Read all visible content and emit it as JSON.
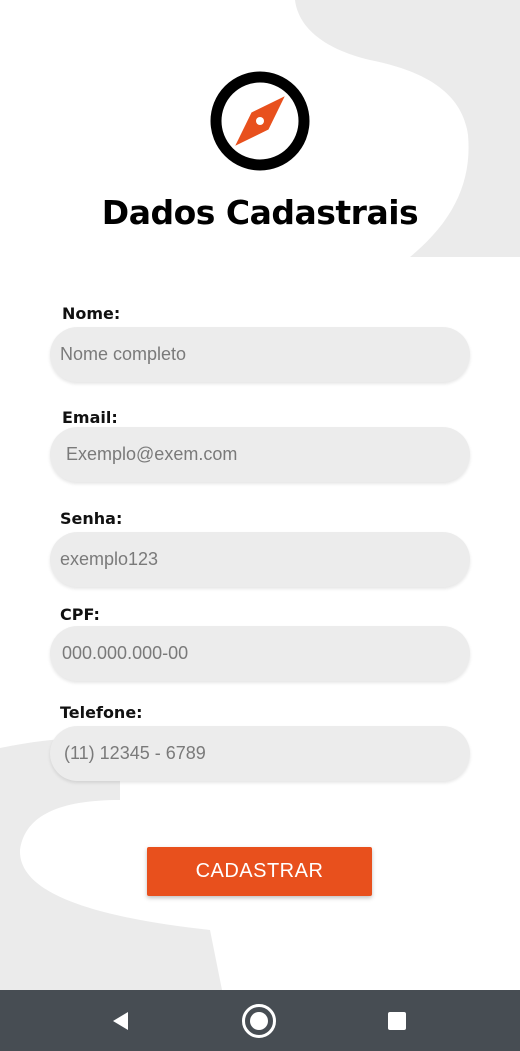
{
  "header": {
    "title": "Dados Cadastrais",
    "logo_icon": "compass-icon"
  },
  "form": {
    "fields": [
      {
        "label": "Nome:",
        "placeholder": "Nome completo"
      },
      {
        "label": "Email:",
        "placeholder": "Exemplo@exem.com"
      },
      {
        "label": "Senha:",
        "placeholder": "exemplo123"
      },
      {
        "label": "CPF:",
        "placeholder": "000.000.000-00"
      },
      {
        "label": "Telefone:",
        "placeholder": "(11) 12345 - 6789"
      }
    ],
    "submit_label": "CADASTRAR"
  },
  "nav_bar": {
    "buttons": [
      "back-icon",
      "home-icon",
      "recents-icon"
    ]
  },
  "colors": {
    "accent": "#e8501d",
    "input_background": "#ececec",
    "background_shape": "#ebebeb",
    "nav_bar": "#474d53"
  }
}
